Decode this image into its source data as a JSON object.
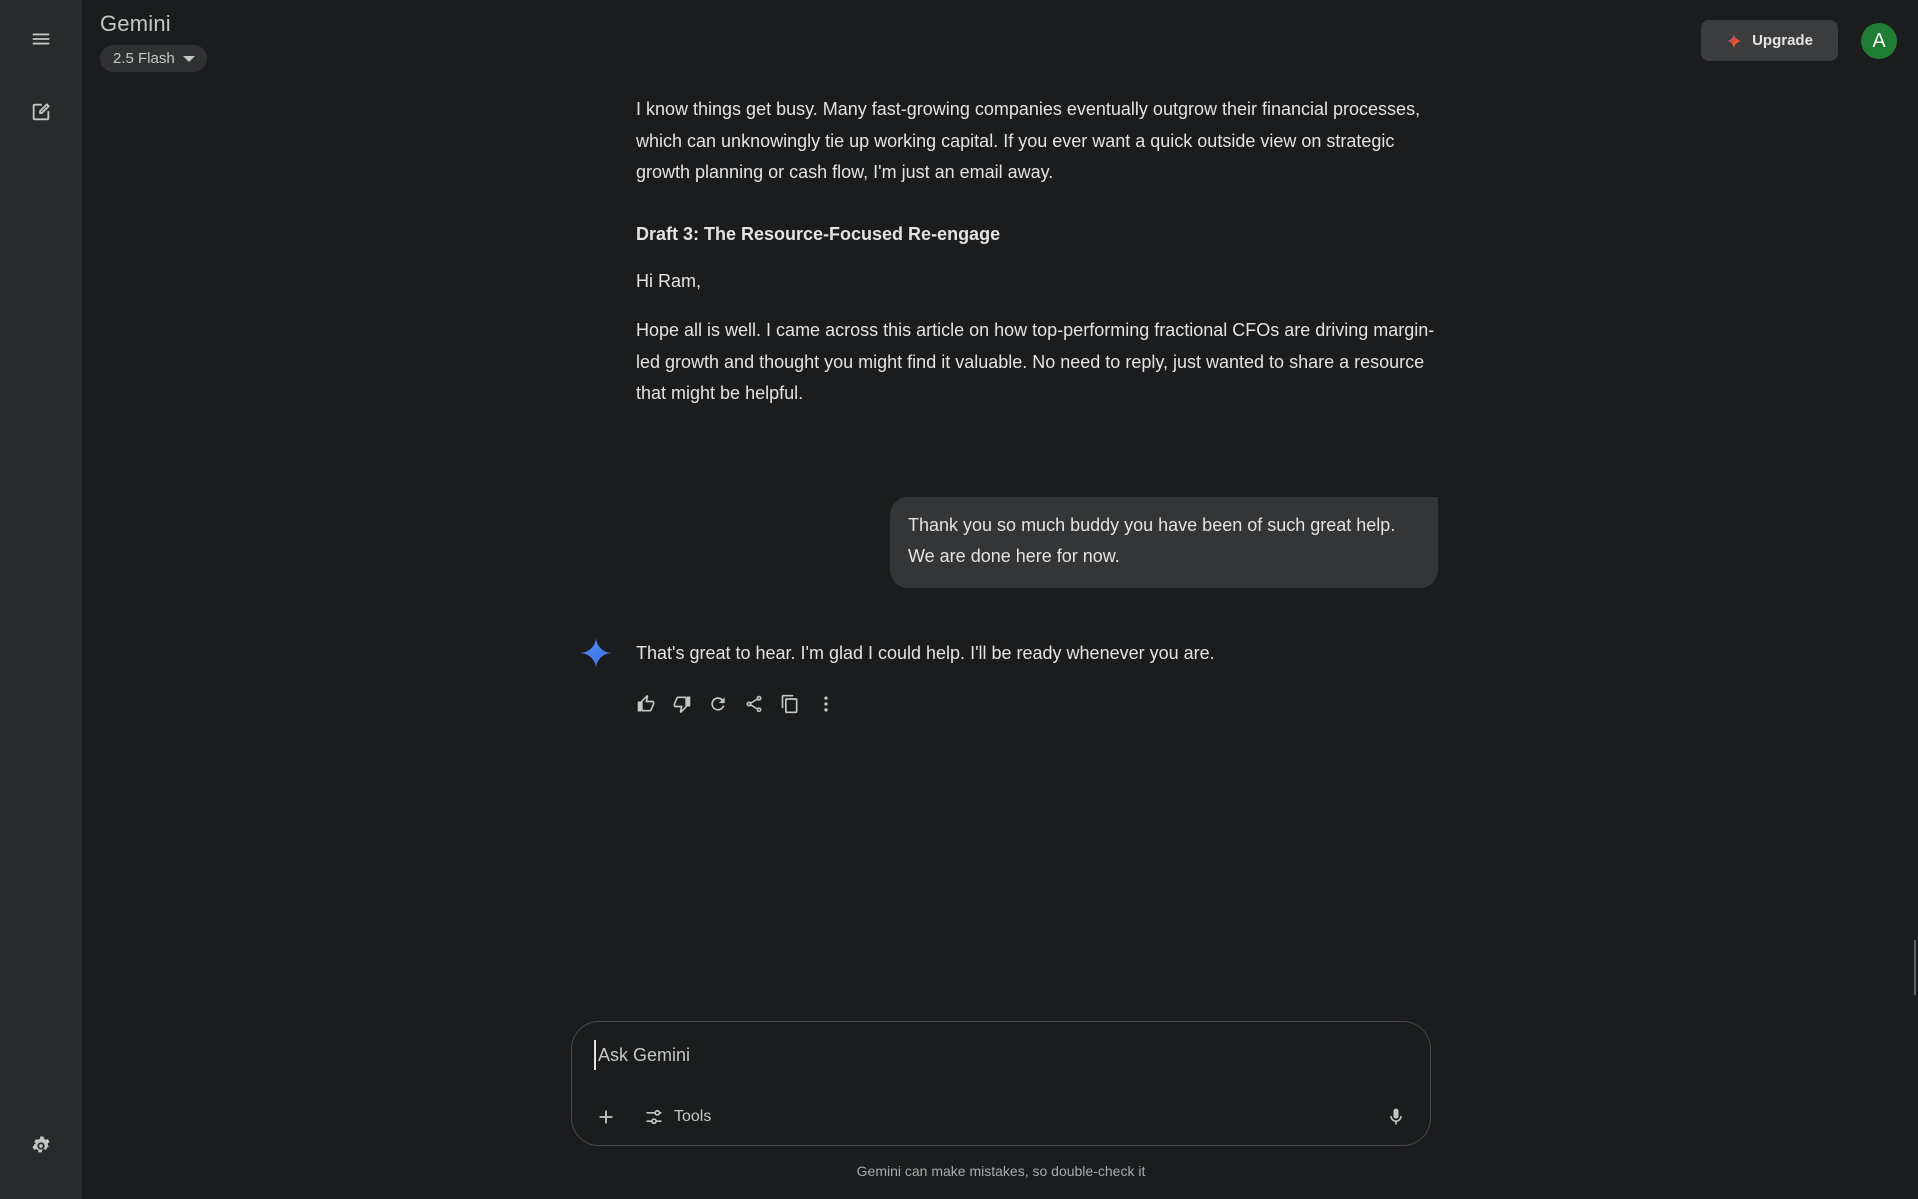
{
  "app": {
    "title": "Gemini",
    "model_label": "2.5 Flash"
  },
  "header": {
    "upgrade_label": "Upgrade",
    "avatar_letter": "A"
  },
  "rail": {
    "icons": [
      "menu-icon",
      "new-chat-icon",
      "settings-icon"
    ]
  },
  "conversation": {
    "response_paragraph_1": "I know things get busy. Many fast-growing companies eventually outgrow their financial processes, which can unknowingly tie up working capital. If you ever want a quick outside view on strategic growth planning or cash flow, I'm just an email away.",
    "draft3_heading": "Draft 3: The Resource-Focused Re-engage",
    "draft3_greeting": "Hi Ram,",
    "draft3_body": "Hope all is well. I came across this article on how top-performing fractional CFOs are driving margin-led growth and thought you might find it valuable. No need to reply, just wanted to share a resource that might be helpful.",
    "user_message": "Thank you so much buddy you have been of such great help. We are done here for now.",
    "final_response": "That's great to hear. I'm glad I could help. I'll be ready whenever you are.",
    "actions": [
      "thumbs-up-icon",
      "thumbs-down-icon",
      "regenerate-icon",
      "share-icon",
      "copy-icon",
      "more-options-icon"
    ]
  },
  "input": {
    "placeholder": "Ask Gemini",
    "value": "",
    "tools_label": "Tools"
  },
  "footer": {
    "disclaimer": "Gemini can make mistakes, so double-check it"
  },
  "colors": {
    "background": "#1b1c1d",
    "rail": "#282a2c",
    "user_bubble": "#333537",
    "avatar": "#1e7d32",
    "spark_accent": "#4285f4"
  }
}
